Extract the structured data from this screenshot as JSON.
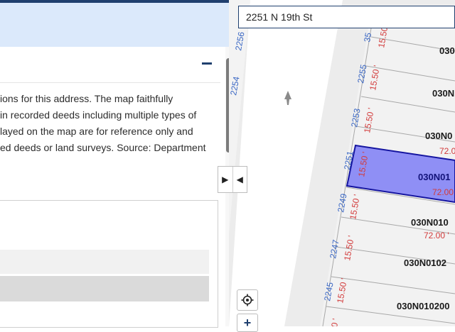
{
  "panel": {
    "description_lines": [
      "ions for this address. The map faithfully",
      " in recorded deeds including multiple types of",
      "layed on the map are for reference only and",
      "ed deeds or land surveys. Source: Department"
    ]
  },
  "search": {
    "value": "2251 N 19th St"
  },
  "map": {
    "street_number_labels": [
      "2256",
      "2254",
      "35",
      "2255",
      "2253",
      "2251",
      "2249",
      "2247",
      "2245"
    ],
    "frontage_labels": [
      "15.50",
      "15.50 '",
      "15.50 '",
      "15.50 '",
      "15.50 '",
      "15.50 '",
      "15.50 '",
      "0 '"
    ],
    "parcel_ids": [
      "030",
      "030N",
      "030N0",
      "030N01",
      "030N010",
      "030N0102",
      "030N010200"
    ],
    "depth_labels": [
      "72.0",
      "72.00",
      "72.00 '"
    ],
    "highlight_fill": "#8f8ff5",
    "highlight_stroke": "#1515a0"
  },
  "controls": {
    "collapse_right_icon": "triangle-right-icon",
    "collapse_left_icon": "triangle-left-icon",
    "locate_icon": "crosshair-icon",
    "zoom_in_label": "+"
  }
}
